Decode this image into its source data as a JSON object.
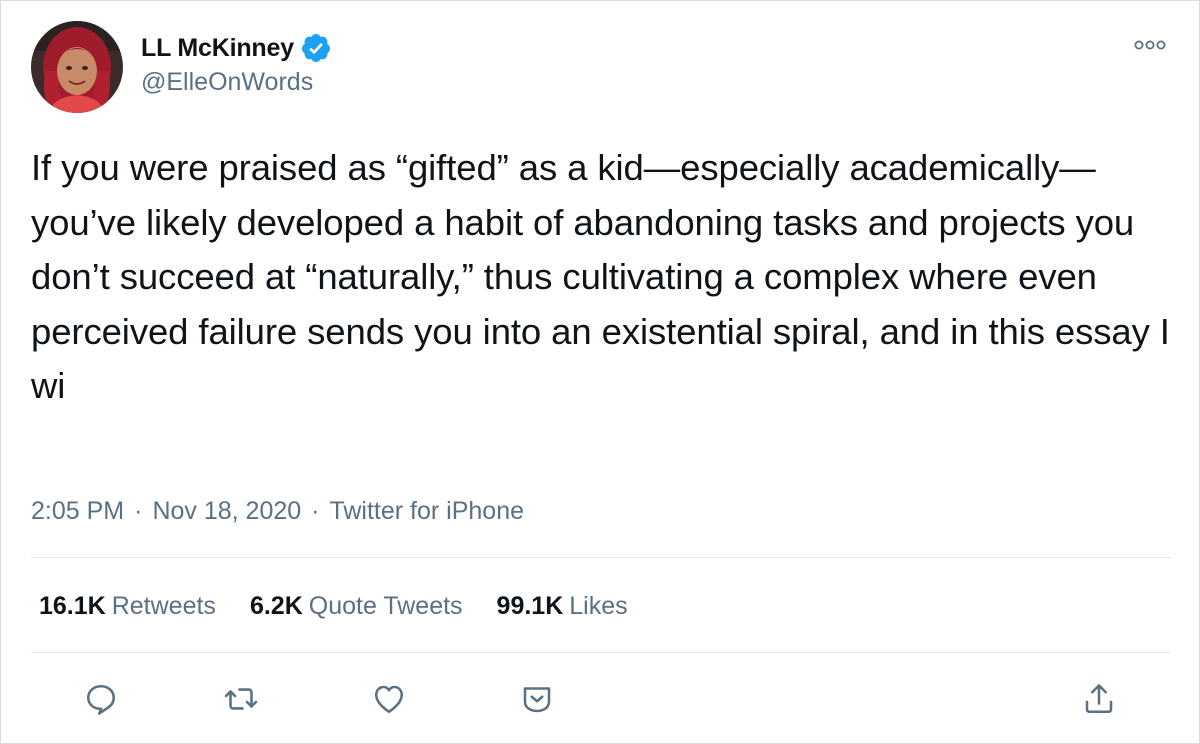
{
  "author": {
    "display_name": "LL McKinney",
    "handle": "@ElleOnWords",
    "verified": true,
    "avatar_icon": "profile-photo-avatar"
  },
  "tweet": {
    "text": "If you were praised as “gifted” as a kid—especially academically—you’ve likely developed a habit of abandoning tasks and projects you don’t succeed at “naturally,” thus cultivating a complex where even perceived failure sends you into an existential spiral, and in this essay I wi",
    "time": "2:05 PM",
    "date": "Nov 18, 2020",
    "source": "Twitter for iPhone",
    "separator": "·"
  },
  "stats": {
    "retweets_count": "16.1K",
    "retweets_label": "Retweets",
    "quotes_count": "6.2K",
    "quotes_label": "Quote Tweets",
    "likes_count": "99.1K",
    "likes_label": "Likes"
  },
  "actions": [
    "reply-icon",
    "retweet-icon",
    "like-icon",
    "share-menu-icon",
    "share-icon"
  ],
  "colors": {
    "text": "#0f1419",
    "secondary": "#5b7083",
    "verified": "#1da1f2",
    "divider": "#e1e6ea"
  }
}
